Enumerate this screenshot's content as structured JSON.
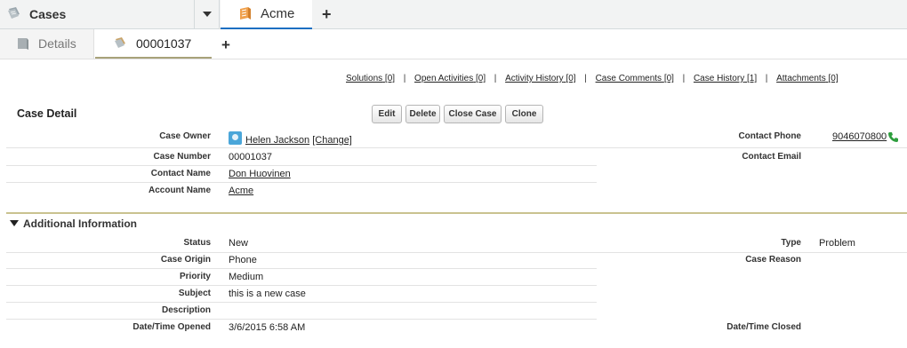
{
  "primary_nav": {
    "app_tab_label": "Cases",
    "open_tab_label": "Acme",
    "add_tab_symbol": "+"
  },
  "sub_nav": {
    "details_label": "Details",
    "case_tab_label": "00001037",
    "add_subtab_symbol": "+"
  },
  "related_list_links": [
    {
      "label": "Solutions",
      "count": "[0]"
    },
    {
      "label": "Open Activities",
      "count": "[0]"
    },
    {
      "label": "Activity History",
      "count": "[0]"
    },
    {
      "label": "Case Comments",
      "count": "[0]"
    },
    {
      "label": "Case History",
      "count": "[1]"
    },
    {
      "label": "Attachments",
      "count": "[0]"
    }
  ],
  "link_separator": "|",
  "case_detail": {
    "title": "Case Detail",
    "buttons": {
      "edit": "Edit",
      "delete": "Delete",
      "close_case": "Close Case",
      "clone": "Clone"
    },
    "fields": {
      "case_owner": {
        "label": "Case Owner",
        "value": "Helen Jackson",
        "change_link": "[Change]"
      },
      "case_number": {
        "label": "Case Number",
        "value": "00001037"
      },
      "contact_name": {
        "label": "Contact Name",
        "value": "Don Huovinen"
      },
      "account_name": {
        "label": "Account Name",
        "value": "Acme"
      },
      "contact_phone": {
        "label": "Contact Phone",
        "value": "9046070800"
      },
      "contact_email": {
        "label": "Contact Email",
        "value": ""
      }
    }
  },
  "additional_information": {
    "title": "Additional Information",
    "fields": {
      "status": {
        "label": "Status",
        "value": "New"
      },
      "case_origin": {
        "label": "Case Origin",
        "value": "Phone"
      },
      "priority": {
        "label": "Priority",
        "value": "Medium"
      },
      "subject": {
        "label": "Subject",
        "value": "this is a new case"
      },
      "description": {
        "label": "Description",
        "value": ""
      },
      "date_time_opened": {
        "label": "Date/Time Opened",
        "value": "3/6/2015 6:58 AM"
      },
      "type": {
        "label": "Type",
        "value": "Problem"
      },
      "case_reason": {
        "label": "Case Reason",
        "value": ""
      },
      "date_time_closed": {
        "label": "Date/Time Closed",
        "value": ""
      }
    }
  },
  "colors": {
    "active_tab_underline": "#1c6fc2",
    "section_rule": "#c9c28f",
    "case_icon": "#9aa6ad",
    "account_icon": "#f0a04b",
    "phone_icon": "#2e9e3e"
  }
}
